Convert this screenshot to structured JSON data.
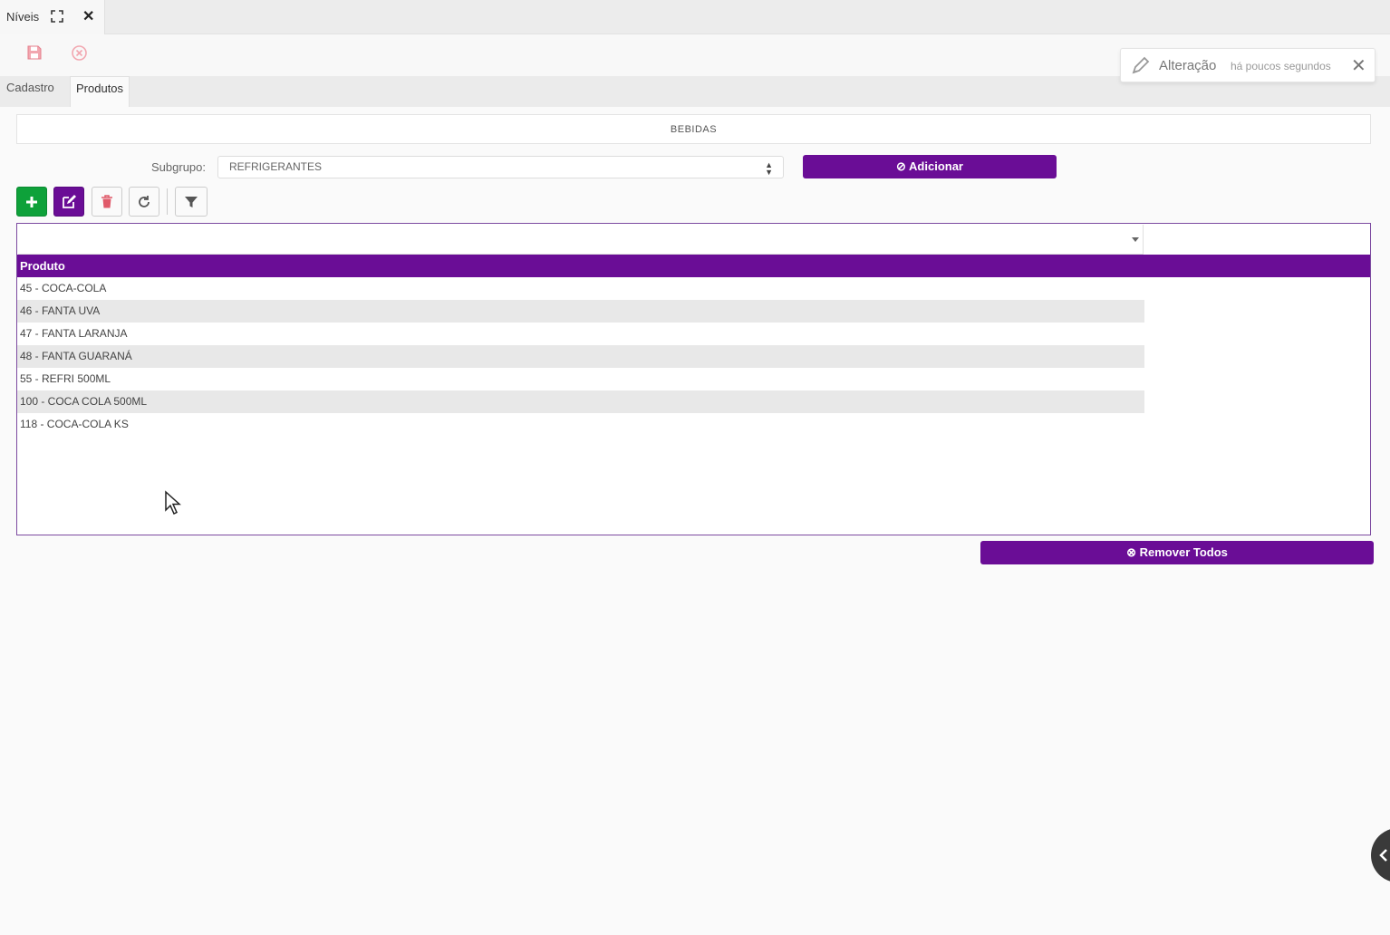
{
  "window": {
    "tab_title": "Níveis",
    "expand_icon": "expand-icon",
    "close_icon": "close-icon"
  },
  "toolbar": {
    "save_icon": "save-icon",
    "cancel_icon": "cancel-circle-icon"
  },
  "tabs": [
    {
      "label": "Cadastro",
      "active": false
    },
    {
      "label": "Produtos",
      "active": true
    }
  ],
  "notification": {
    "title": "Alteração",
    "time": "há poucos segundos",
    "icon": "pencil-icon"
  },
  "group": {
    "name": "BEBIDAS"
  },
  "subgroup": {
    "label": "Subgrupo:",
    "selected": "REFRIGERANTES"
  },
  "buttons": {
    "add_label": "Adicionar",
    "remove_all_label": "Remover Todos"
  },
  "action_icons": [
    "plus-icon",
    "edit-icon",
    "trash-icon",
    "refresh-icon",
    "filter-icon"
  ],
  "grid": {
    "column_header": "Produto",
    "rows": [
      "45 - COCA-COLA",
      "46 - FANTA UVA",
      "47 - FANTA LARANJA",
      "48 - FANTA GUARANÁ",
      "55 - REFRI 500ML",
      "100 - COCA COLA 500ML",
      "118 - COCA-COLA KS"
    ]
  },
  "colors": {
    "accent": "#6a0d96",
    "add_green": "#0ea13a",
    "danger": "#e05a6a"
  }
}
